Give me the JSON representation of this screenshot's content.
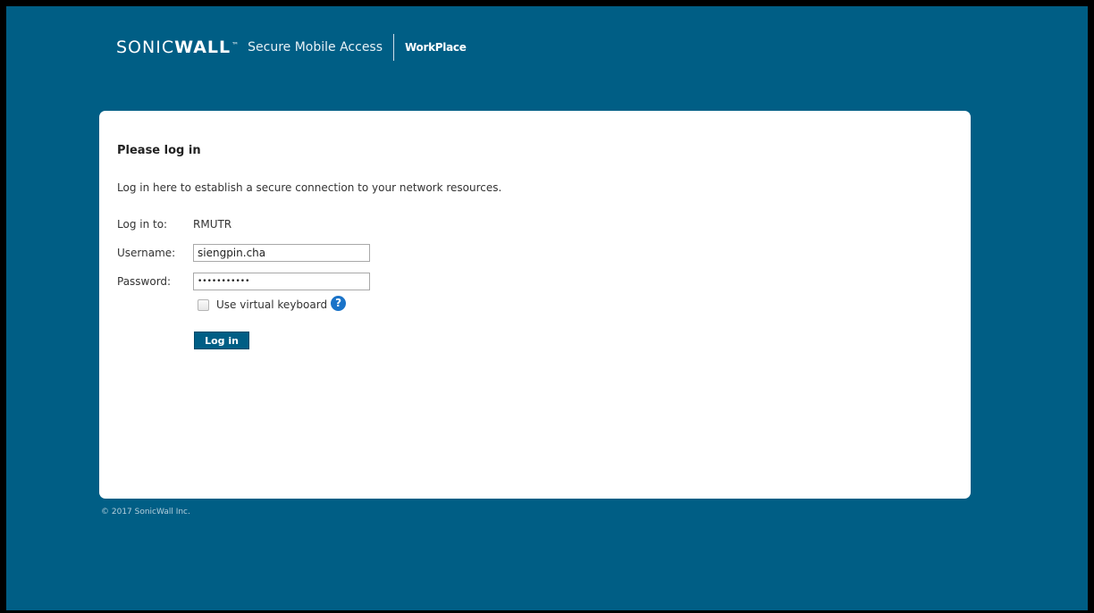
{
  "brand": {
    "sonic": "SONIC",
    "wall": "WALL",
    "tm": "™",
    "product": "Secure Mobile Access",
    "app": "WorkPlace"
  },
  "login": {
    "title": "Please log in",
    "intro": "Log in here to establish a secure connection to your network resources.",
    "realm_label": "Log in to:",
    "realm_value": "RMUTR",
    "username_label": "Username:",
    "username_value": "siengpin.cha",
    "password_label": "Password:",
    "password_value": "•••••••••••",
    "virtual_keyboard_label": "Use virtual keyboard",
    "virtual_keyboard_checked": false,
    "help_icon_glyph": "?",
    "submit_label": "Log in"
  },
  "footer": {
    "copyright": "© 2017 SonicWall Inc."
  },
  "colors": {
    "background": "#005e85",
    "card": "#ffffff",
    "button": "#005e85",
    "help_icon": "#1a73c8"
  }
}
